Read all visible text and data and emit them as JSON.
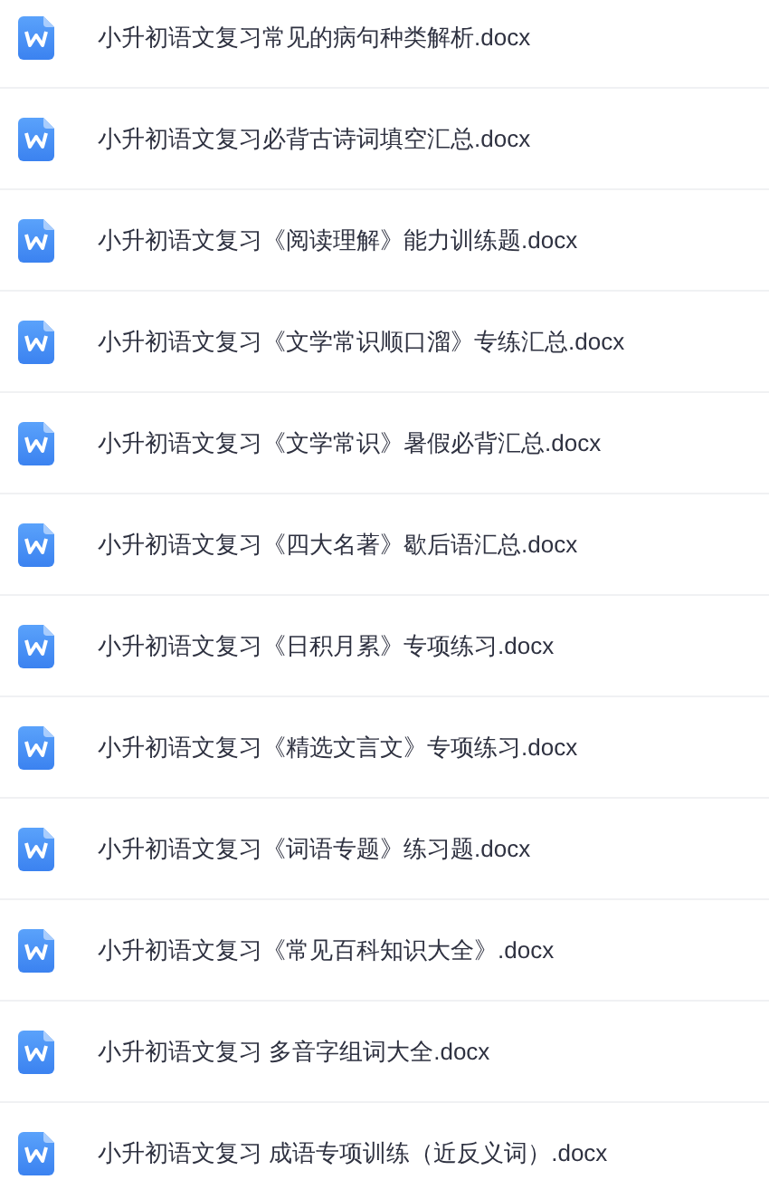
{
  "files": [
    {
      "name": "小升初语文复习常见的病句种类解析.docx"
    },
    {
      "name": "小升初语文复习必背古诗词填空汇总.docx"
    },
    {
      "name": "小升初语文复习《阅读理解》能力训练题.docx"
    },
    {
      "name": "小升初语文复习《文学常识顺口溜》专练汇总.docx"
    },
    {
      "name": "小升初语文复习《文学常识》暑假必背汇总.docx"
    },
    {
      "name": "小升初语文复习《四大名著》歇后语汇总.docx"
    },
    {
      "name": "小升初语文复习《日积月累》专项练习.docx"
    },
    {
      "name": "小升初语文复习《精选文言文》专项练习.docx"
    },
    {
      "name": "小升初语文复习《词语专题》练习题.docx"
    },
    {
      "name": "小升初语文复习《常见百科知识大全》.docx"
    },
    {
      "name": "小升初语文复习 多音字组词大全.docx"
    },
    {
      "name": "小升初语文复习 成语专项训练（近反义词）.docx"
    }
  ]
}
